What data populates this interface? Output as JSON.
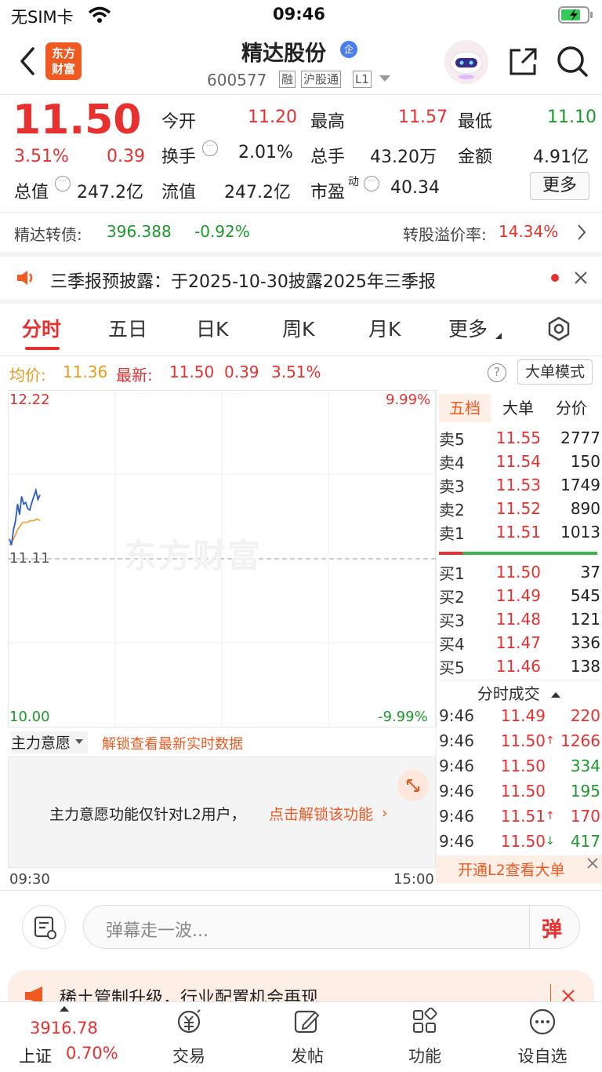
{
  "status": {
    "carrier": "无SIM卡",
    "time": "09:46"
  },
  "header": {
    "logo_line1": "东方",
    "logo_line2": "财富",
    "stock_name": "精达股份",
    "badge": "企",
    "code": "600577",
    "tag1": "融",
    "tag2": "沪股通",
    "tag3": "L1"
  },
  "quote": {
    "price": "11.50",
    "pct": "3.51%",
    "change": "0.39",
    "jinkai_label": "今开",
    "jinkai": "11.20",
    "zuigao_label": "最高",
    "zuigao": "11.57",
    "zuidi_label": "最低",
    "zuidi": "11.10",
    "huanshou_label": "换手",
    "huanshou": "2.01%",
    "zongshou_label": "总手",
    "zongshou": "43.20万",
    "jine_label": "金额",
    "jine": "4.91亿",
    "zongzhi_label": "总值",
    "zongzhi": "247.2亿",
    "liuzhi_label": "流值",
    "liuzhi": "247.2亿",
    "shiying_label": "市盈",
    "shiying_sup": "动",
    "shiying": "40.34",
    "more_btn": "更多"
  },
  "bond": {
    "label": "精达转债:",
    "price": "396.388",
    "pct": "-0.92%",
    "premium_label": "转股溢价率:",
    "premium": "14.34%"
  },
  "notice": {
    "text": "三季报预披露：于2025-10-30披露2025年三季报"
  },
  "tabs": [
    "分时",
    "五日",
    "日K",
    "周K",
    "月K",
    "更多"
  ],
  "info_bar": {
    "avg_label": "均价:",
    "avg": "11.36",
    "latest_label": "最新:",
    "latest": "11.50",
    "chg": "0.39",
    "pct": "3.51%",
    "mode_btn": "大单模式"
  },
  "chart": {
    "y_top": "12.22",
    "y_mid": "11.11",
    "y_bottom": "10.00",
    "pct_top": "9.99%",
    "pct_bottom": "-9.99%",
    "watermark": "东方财富",
    "x_start": "09:30",
    "x_end": "15:00"
  },
  "chart_data": {
    "type": "line",
    "series": [
      {
        "values": [
          11.24,
          11.2,
          11.3,
          11.36,
          11.47,
          11.4,
          11.52,
          11.47,
          11.48,
          11.44,
          11.43,
          11.48,
          11.52,
          11.56,
          11.5,
          11.53
        ]
      },
      {
        "values": [
          11.2,
          11.21,
          11.24,
          11.27,
          11.3,
          11.32,
          11.34,
          11.35,
          11.35,
          11.35,
          11.36,
          11.36,
          11.36,
          11.37,
          11.37,
          11.36
        ]
      }
    ],
    "ylim": [
      10.0,
      12.22
    ]
  },
  "order_book": {
    "tabs": [
      "五档",
      "大单",
      "分价"
    ],
    "asks": [
      {
        "label": "卖5",
        "price": "11.55",
        "vol": "2777"
      },
      {
        "label": "卖4",
        "price": "11.54",
        "vol": "150"
      },
      {
        "label": "卖3",
        "price": "11.53",
        "vol": "1749"
      },
      {
        "label": "卖2",
        "price": "11.52",
        "vol": "890"
      },
      {
        "label": "卖1",
        "price": "11.51",
        "vol": "1013"
      }
    ],
    "bids": [
      {
        "label": "买1",
        "price": "11.50",
        "vol": "37"
      },
      {
        "label": "买2",
        "price": "11.49",
        "vol": "545"
      },
      {
        "label": "买3",
        "price": "11.48",
        "vol": "121"
      },
      {
        "label": "买4",
        "price": "11.47",
        "vol": "336"
      },
      {
        "label": "买5",
        "price": "11.46",
        "vol": "138"
      }
    ]
  },
  "ticks": {
    "title": "分时成交",
    "rows": [
      {
        "time": "9:46",
        "price": "11.49",
        "arrow": "",
        "vol": "220",
        "color": "#e8302e"
      },
      {
        "time": "9:46",
        "price": "11.50",
        "arrow": "↑",
        "vol": "1266",
        "color": "#e8302e"
      },
      {
        "time": "9:46",
        "price": "11.50",
        "arrow": "",
        "vol": "334",
        "color": "#1b9a2c"
      },
      {
        "time": "9:46",
        "price": "11.50",
        "arrow": "",
        "vol": "195",
        "color": "#1b9a2c"
      },
      {
        "time": "9:46",
        "price": "11.51",
        "arrow": "↑",
        "vol": "170",
        "color": "#e8302e"
      },
      {
        "time": "9:46",
        "price": "11.50",
        "arrow": "↓",
        "vol": "417",
        "color": "#1b9a2c"
      }
    ]
  },
  "l2_banner": "开通L2查看大单",
  "main_force": {
    "select_label": "主力意愿",
    "unlock_link": "解锁查看最新实时数据",
    "msg": "主力意愿功能仅针对L2用户，",
    "msg_link": "点击解锁该功能"
  },
  "danmu": {
    "placeholder": "弹幕走一波...",
    "send": "弹"
  },
  "promo": {
    "text": "稀土管制升级，行业配置机会再现"
  },
  "bottom_nav": {
    "index_value": "3916.78",
    "index_name": "上证",
    "index_pct": "0.70%",
    "items": [
      "交易",
      "发帖",
      "功能",
      "设自选"
    ]
  }
}
